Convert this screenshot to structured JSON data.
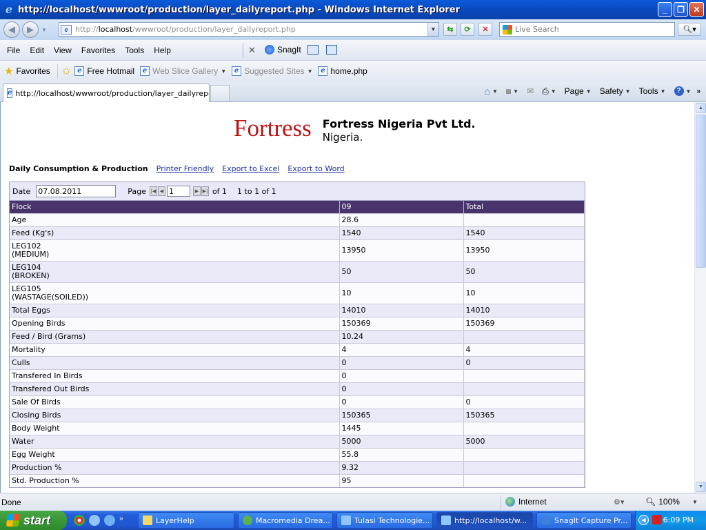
{
  "window": {
    "title": "http://localhost/wwwroot/production/layer_dailyreport.php - Windows Internet Explorer",
    "min_label": "_",
    "max_label": "❐",
    "close_label": "✕"
  },
  "address": {
    "scheme": "http://",
    "host": "localhost",
    "path": "/wwwroot/production/layer_dailyreport.php"
  },
  "search": {
    "placeholder": "Live Search"
  },
  "menu": {
    "items": [
      "File",
      "Edit",
      "View",
      "Favorites",
      "Tools",
      "Help"
    ],
    "snagit_label": "SnagIt"
  },
  "favorites": {
    "label": "Favorites",
    "links": [
      {
        "label": "Free Hotmail",
        "muted": false
      },
      {
        "label": "Web Slice Gallery",
        "muted": true
      },
      {
        "label": "Suggested Sites",
        "muted": true
      },
      {
        "label": "home.php",
        "muted": false
      }
    ]
  },
  "tab": {
    "title": "http://localhost/wwwroot/production/layer_dailyrepor..."
  },
  "commandbar": {
    "page": "Page",
    "safety": "Safety",
    "tools": "Tools",
    "help": "?",
    "more": "»"
  },
  "page": {
    "logo": "Fortress",
    "company": "Fortress Nigeria Pvt Ltd.",
    "country": "Nigeria.",
    "report_title": "Daily Consumption & Production",
    "links": {
      "printer": "Printer Friendly",
      "excel": "Export to Excel",
      "word": "Export to Word"
    },
    "filter": {
      "date_label": "Date",
      "date_value": "07.08.2011",
      "page_label": "Page",
      "page_value": "1",
      "of_text": "of 1",
      "range_text": "1 to 1 of 1"
    },
    "table": {
      "headers": [
        "Flock",
        "09",
        "Total"
      ],
      "rows": [
        {
          "label": [
            "Age"
          ],
          "v1": "28.6",
          "v2": ""
        },
        {
          "label": [
            "Feed (Kg's)"
          ],
          "v1": "1540",
          "v2": "1540"
        },
        {
          "label": [
            "LEG102",
            "(MEDIUM)"
          ],
          "v1": "13950",
          "v2": "13950"
        },
        {
          "label": [
            "LEG104",
            "(BROKEN)"
          ],
          "v1": "50",
          "v2": "50"
        },
        {
          "label": [
            "LEG105",
            "(WASTAGE(SOILED))"
          ],
          "v1": "10",
          "v2": "10"
        },
        {
          "label": [
            "Total Eggs"
          ],
          "v1": "14010",
          "v2": "14010"
        },
        {
          "label": [
            "Opening Birds"
          ],
          "v1": "150369",
          "v2": "150369"
        },
        {
          "label": [
            "Feed / Bird (Grams)"
          ],
          "v1": "10.24",
          "v2": ""
        },
        {
          "label": [
            "Mortality"
          ],
          "v1": "4",
          "v2": "4"
        },
        {
          "label": [
            "Culls"
          ],
          "v1": "0",
          "v2": "0"
        },
        {
          "label": [
            "Transfered In Birds"
          ],
          "v1": "0",
          "v2": ""
        },
        {
          "label": [
            "Transfered Out Birds"
          ],
          "v1": "0",
          "v2": ""
        },
        {
          "label": [
            "Sale Of Birds"
          ],
          "v1": "0",
          "v2": "0"
        },
        {
          "label": [
            "Closing Birds"
          ],
          "v1": "150365",
          "v2": "150365"
        },
        {
          "label": [
            "Body Weight"
          ],
          "v1": "1445",
          "v2": ""
        },
        {
          "label": [
            "Water"
          ],
          "v1": "5000",
          "v2": "5000"
        },
        {
          "label": [
            "Egg Weight"
          ],
          "v1": "55.8",
          "v2": ""
        },
        {
          "label": [
            "Production %"
          ],
          "v1": "9.32",
          "v2": ""
        },
        {
          "label": [
            "Std. Production %"
          ],
          "v1": "95",
          "v2": ""
        }
      ]
    }
  },
  "status": {
    "text": "Done",
    "zone": "Internet",
    "zoom": "100%"
  },
  "taskbar": {
    "start": "start",
    "tasks": [
      {
        "label": "LayerHelp",
        "active": false
      },
      {
        "label": "Macromedia Drea...",
        "active": false
      },
      {
        "label": "Tulasi Technologie...",
        "active": false
      },
      {
        "label": "http://localhost/w...",
        "active": true
      },
      {
        "label": "SnagIt Capture Pr...",
        "active": false
      }
    ],
    "clock": "6:09 PM"
  },
  "colors": {
    "brand_red": "#c01111",
    "header_purple": "#48346b",
    "link_blue": "#1b2ea3"
  }
}
